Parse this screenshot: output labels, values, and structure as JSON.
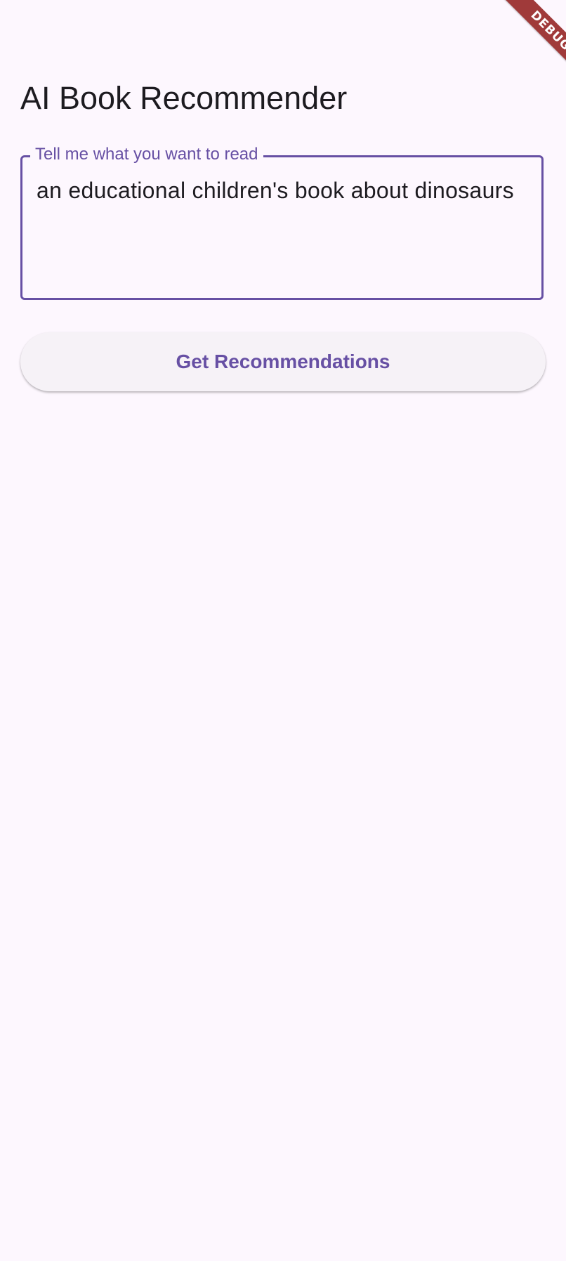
{
  "app": {
    "title": "AI Book Recommender"
  },
  "query_field": {
    "label": "Tell me what you want to read",
    "value": "an educational children's book about dinosaurs"
  },
  "actions": {
    "get_recommendations_label": "Get Recommendations"
  },
  "debug_banner": {
    "label": "DEBUG"
  },
  "colors": {
    "background": "#fdf7fe",
    "accent": "#6750a4",
    "text": "#1d1b20",
    "button_surface": "#f6f2f7",
    "debug_banner": "#a03a3a"
  }
}
